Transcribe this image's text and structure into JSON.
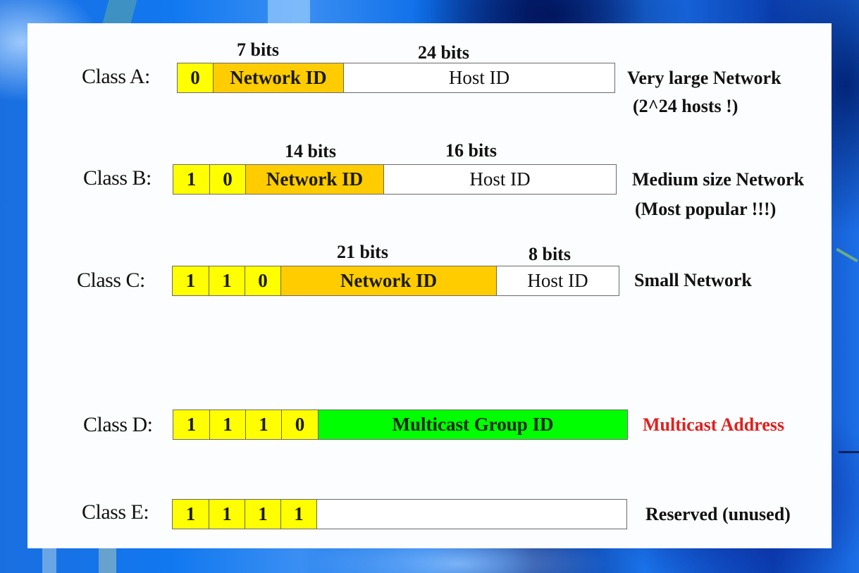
{
  "colors": {
    "fixed_bit": "#ffff00",
    "network_id": "#ffcc00",
    "host_id": "#ffffff",
    "multicast_group": "#00ff00",
    "highlight_text": "#e0201e"
  },
  "classes": [
    {
      "label": "Class A:",
      "fixed_bits": [
        "0"
      ],
      "network_bits_label": "7 bits",
      "network_label": "Network ID",
      "host_bits_label": "24 bits",
      "host_label": "Host ID",
      "description": [
        "Very large Network",
        "(2^24 hosts !)"
      ]
    },
    {
      "label": "Class B:",
      "fixed_bits": [
        "1",
        "0"
      ],
      "network_bits_label": "14 bits",
      "network_label": "Network ID",
      "host_bits_label": "16 bits",
      "host_label": "Host ID",
      "description": [
        "Medium size Network",
        "(Most popular !!!)"
      ]
    },
    {
      "label": "Class C:",
      "fixed_bits": [
        "1",
        "1",
        "0"
      ],
      "network_bits_label": "21 bits",
      "network_label": "Network ID",
      "host_bits_label": "8 bits",
      "host_label": "Host ID",
      "description": [
        "Small Network"
      ]
    },
    {
      "label": "Class D:",
      "fixed_bits": [
        "1",
        "1",
        "1",
        "0"
      ],
      "group_label": "Multicast Group ID",
      "description": [
        "Multicast Address"
      ]
    },
    {
      "label": "Class E:",
      "fixed_bits": [
        "1",
        "1",
        "1",
        "1"
      ],
      "description": [
        "Reserved (unused)"
      ]
    }
  ]
}
